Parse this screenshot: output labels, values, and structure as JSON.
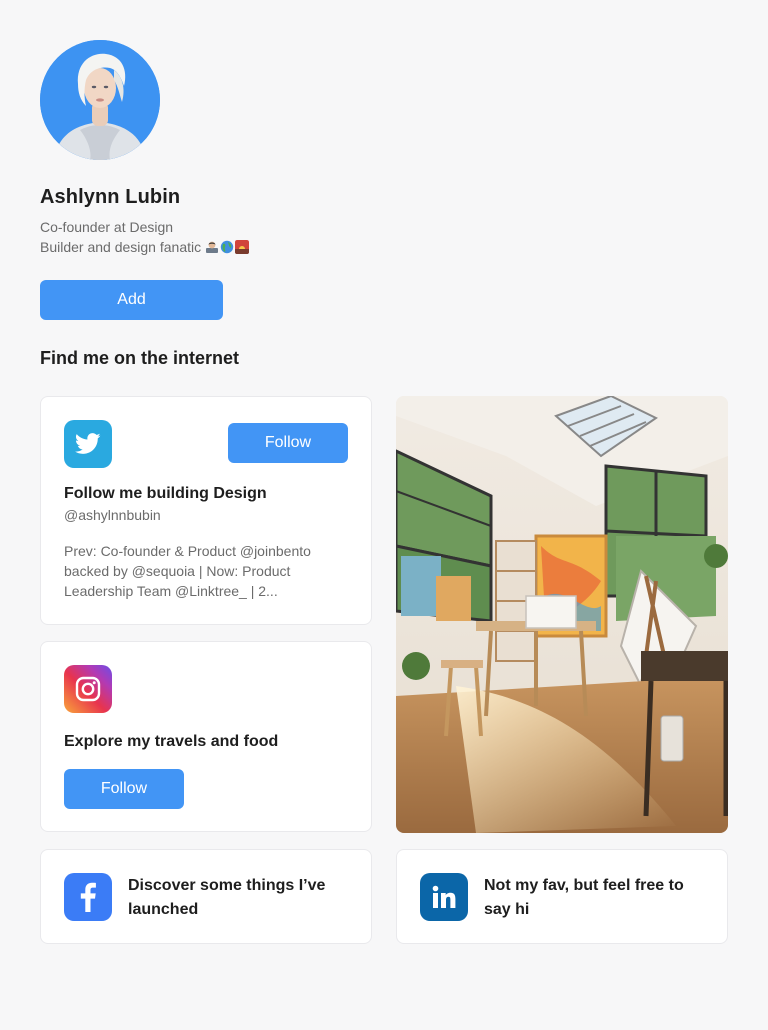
{
  "profile": {
    "name": "Ashlynn Lubin",
    "bio_line1": "Co-founder at Design",
    "bio_line2": "Builder and design fanatic",
    "bio_emojis": [
      "technologist-emoji",
      "globe-emoji",
      "sunrise-emoji"
    ],
    "add_label": "Add"
  },
  "section_title": "Find me on the internet",
  "twitter": {
    "icon": "twitter-icon",
    "follow_label": "Follow",
    "title": "Follow me building Design",
    "handle": "@ashylnnbubin",
    "desc_line1": "Prev: Co-founder & Product @joinbento",
    "desc_line2": "backed by @sequoia | Now: Product",
    "desc_line3": "Leadership Team @Linktree_ | 2..."
  },
  "instagram": {
    "icon": "instagram-icon",
    "title": "Explore my travels and food",
    "follow_label": "Follow"
  },
  "facebook": {
    "icon": "facebook-icon",
    "line1": "Discover some things I’ve",
    "line2": "launched"
  },
  "linkedin": {
    "icon": "linkedin-icon",
    "line1": "Not my fav, but feel free to",
    "line2": "say hi"
  },
  "colors": {
    "accent": "#4295f5",
    "twitter": "#2aa9e0",
    "facebook": "#3b7cf6",
    "linkedin": "#0b66a8",
    "background": "#f7f7f8"
  }
}
